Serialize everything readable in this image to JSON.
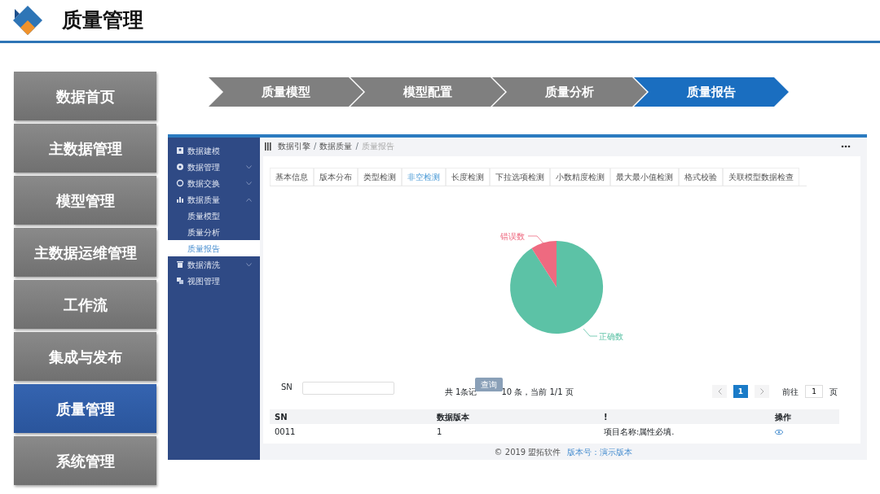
{
  "slide": {
    "title": "质量管理"
  },
  "nav": [
    {
      "label": "数据首页",
      "selected": false
    },
    {
      "label": "主数据管理",
      "selected": false
    },
    {
      "label": "模型管理",
      "selected": false
    },
    {
      "label": "主数据运维管理",
      "selected": false
    },
    {
      "label": "工作流",
      "selected": false
    },
    {
      "label": "集成与发布",
      "selected": false
    },
    {
      "label": "质量管理",
      "selected": true
    },
    {
      "label": "系统管理",
      "selected": false
    }
  ],
  "steps": [
    {
      "label": "质量模型",
      "selected": false
    },
    {
      "label": "模型配置",
      "selected": false
    },
    {
      "label": "质量分析",
      "selected": false
    },
    {
      "label": "质量报告",
      "selected": true
    }
  ],
  "app": {
    "sidebar": [
      {
        "label": "数据建模",
        "kind": "link"
      },
      {
        "label": "数据管理",
        "kind": "group",
        "expanded": false
      },
      {
        "label": "数据交换",
        "kind": "group",
        "expanded": false
      },
      {
        "label": "数据质量",
        "kind": "group",
        "expanded": true,
        "children": [
          {
            "label": "质量模型",
            "selected": false
          },
          {
            "label": "质量分析",
            "selected": false
          },
          {
            "label": "质量报告",
            "selected": true
          }
        ]
      },
      {
        "label": "数据清洗",
        "kind": "group",
        "expanded": false
      },
      {
        "label": "视图管理",
        "kind": "link"
      }
    ],
    "breadcrumb": [
      "数据引擎",
      "数据质量",
      "质量报告"
    ],
    "breadcrumb_separator": "/",
    "tabs": [
      {
        "label": "基本信息",
        "selected": false
      },
      {
        "label": "版本分布",
        "selected": false
      },
      {
        "label": "类型检测",
        "selected": false
      },
      {
        "label": "非空检测",
        "selected": true
      },
      {
        "label": "长度检测",
        "selected": false
      },
      {
        "label": "下拉选项检测",
        "selected": false
      },
      {
        "label": "小数精度检测",
        "selected": false
      },
      {
        "label": "最大最小值检测",
        "selected": false
      },
      {
        "label": "格式校验",
        "selected": false
      },
      {
        "label": "关联模型数据检查",
        "selected": false
      }
    ],
    "pie_labels": [
      {
        "text": "错误数",
        "color": "#ee6a80"
      },
      {
        "text": "正确数",
        "color": "#5cc2a6"
      }
    ],
    "search": {
      "label": "SN",
      "button": "查询"
    },
    "summary": [
      "共 1条记",
      "10 条，当前 1/1 页"
    ],
    "pager": {
      "page": "1",
      "goto": "前往",
      "value": "1",
      "unit": "页"
    },
    "table": {
      "columns": [
        "SN",
        "数据版本",
        "!",
        "操作"
      ],
      "rows": [
        [
          "0011",
          "1",
          "项目名称:属性必填."
        ]
      ]
    },
    "footer": {
      "copyright": "© 2019 盟拓软件",
      "version": "版本号：演示版本"
    }
  }
}
